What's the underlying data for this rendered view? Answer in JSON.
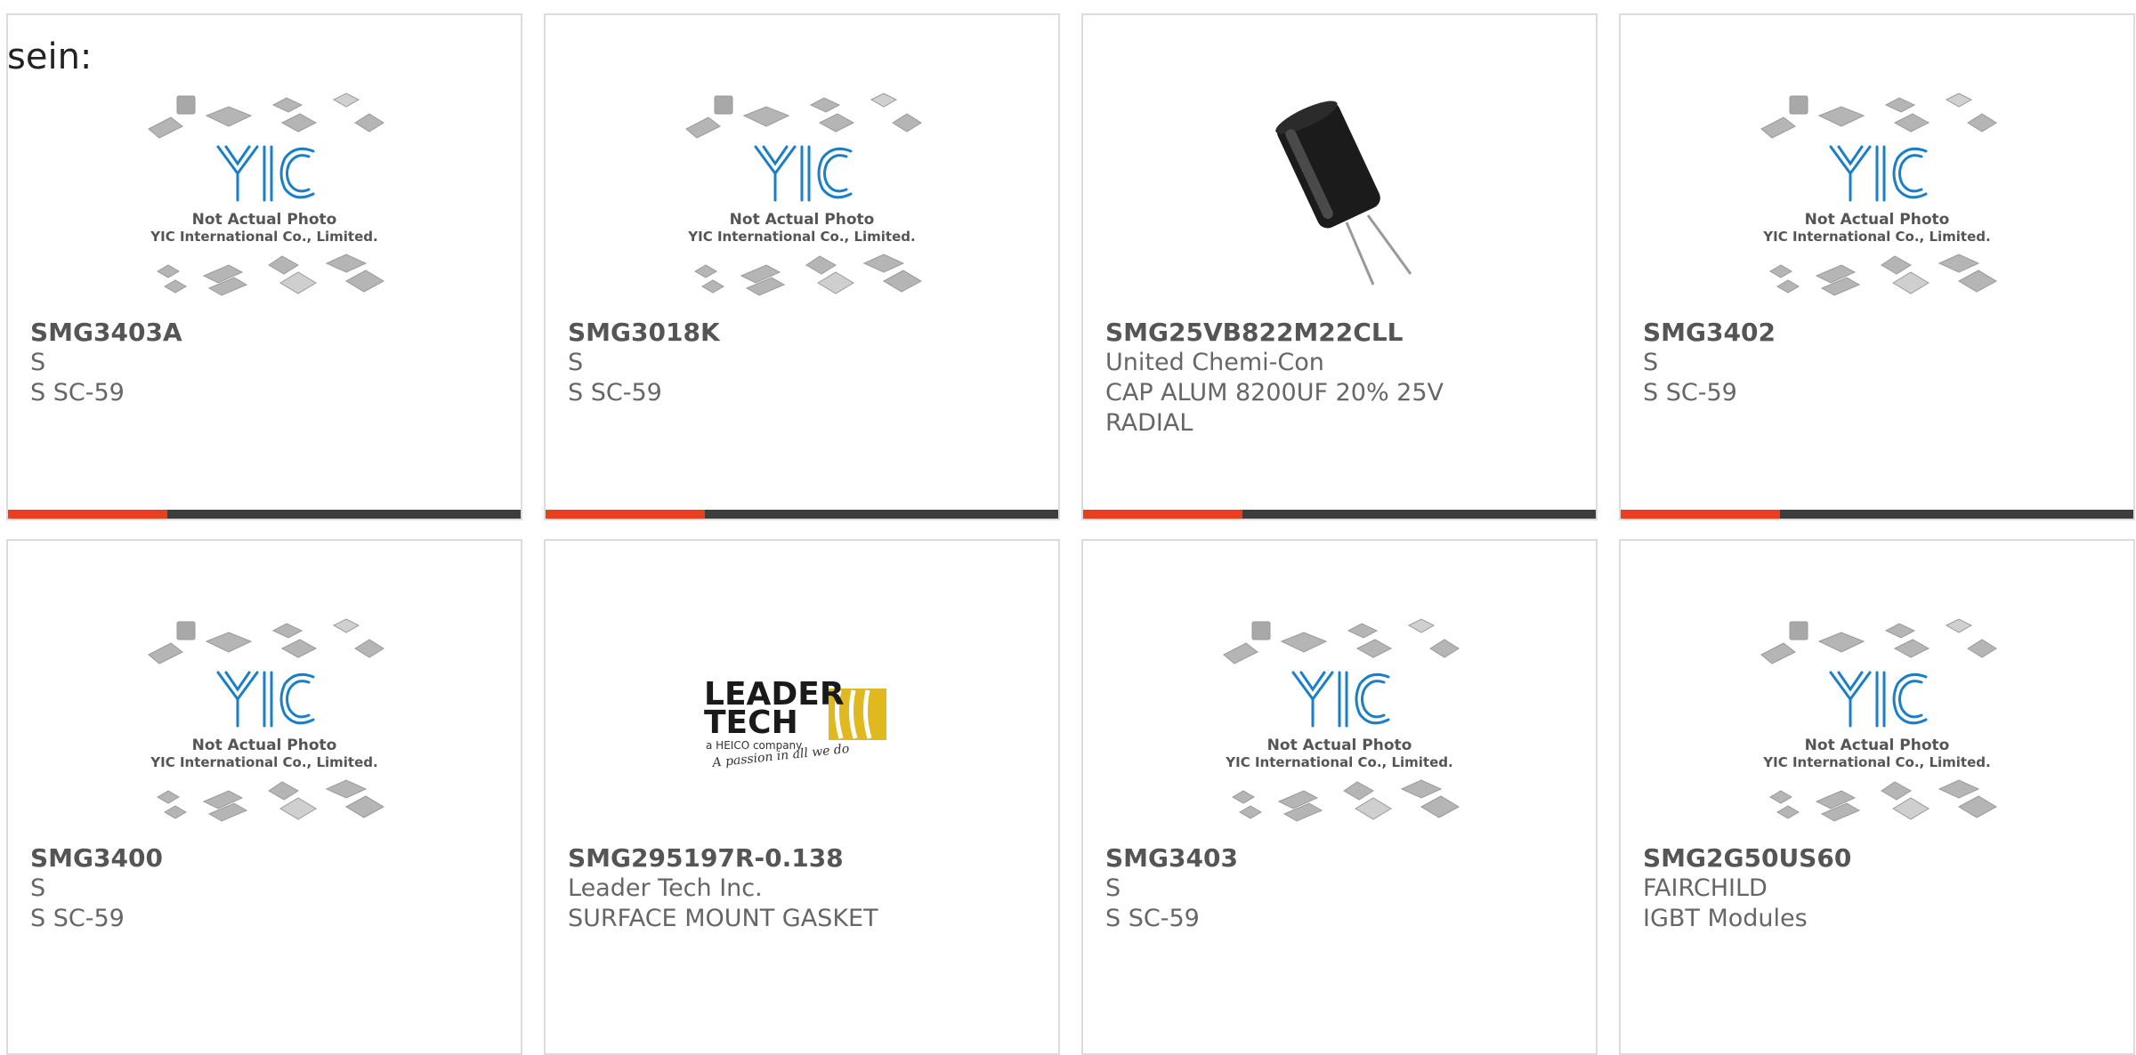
{
  "lead_text": "sein:",
  "colors": {
    "accent": "#e8401c",
    "bar_track": "#3d3d3d",
    "yic_blue": "#1a7fc7",
    "card_border": "#dcdcdc"
  },
  "placeholder": {
    "line1": "Not Actual Photo",
    "line2": "YIC International Co., Limited."
  },
  "leadertech_logo": {
    "word1": "LEADER",
    "word2": "TECH",
    "tagline": "a HEICO company",
    "slogan": "A passion in all we do"
  },
  "cards": [
    {
      "part": "SMG3403A",
      "line1": "S",
      "line2": "S SC-59",
      "image": "yic-placeholder",
      "progress": 0.31
    },
    {
      "part": "SMG3018K",
      "line1": "S",
      "line2": "S SC-59",
      "image": "yic-placeholder",
      "progress": 0.31
    },
    {
      "part": "SMG25VB822M22CLL",
      "line1": "United Chemi-Con",
      "line2": "CAP ALUM 8200UF 20% 25V",
      "line3": "RADIAL",
      "image": "capacitor-photo",
      "progress": 0.31
    },
    {
      "part": "SMG3402",
      "line1": "S",
      "line2": "S SC-59",
      "image": "yic-placeholder",
      "progress": 0.31
    },
    {
      "part": "SMG3400",
      "line1": "S",
      "line2": "S SC-59",
      "image": "yic-placeholder"
    },
    {
      "part": "SMG295197R-0.138",
      "line1": "Leader Tech Inc.",
      "line2": "SURFACE MOUNT GASKET",
      "image": "leadertech-logo"
    },
    {
      "part": "SMG3403",
      "line1": "S",
      "line2": "S SC-59",
      "image": "yic-placeholder"
    },
    {
      "part": "SMG2G50US60",
      "line1": "FAIRCHILD",
      "line2": "IGBT Modules",
      "image": "yic-placeholder"
    }
  ]
}
